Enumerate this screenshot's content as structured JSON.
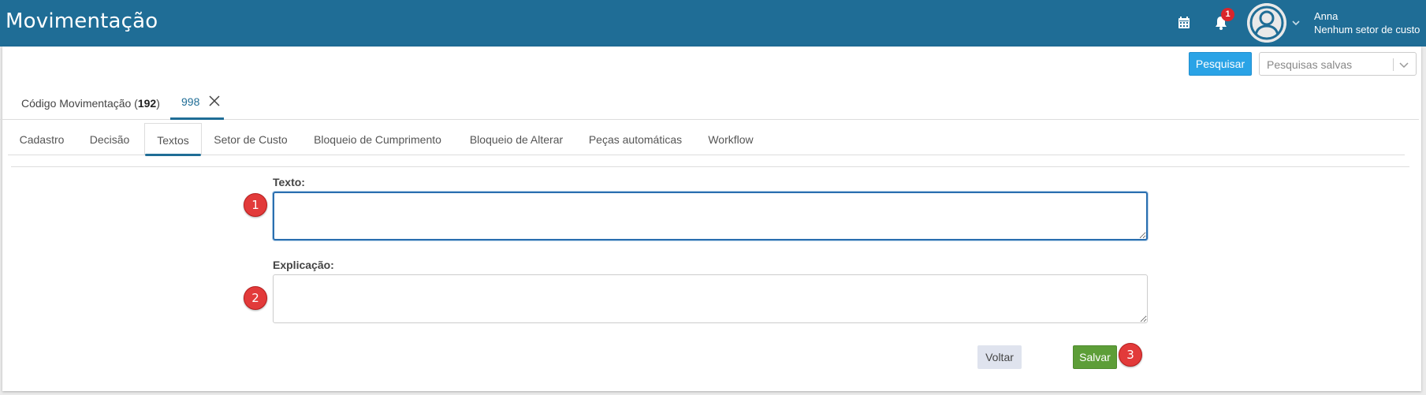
{
  "header": {
    "title": "Movimentação",
    "notification_count": "1",
    "user_name": "Anna",
    "user_sector": "Nenhum setor de custo"
  },
  "search": {
    "button_label": "Pesquisar",
    "saved_placeholder": "Pesquisas salvas"
  },
  "record_tabs": {
    "code_label": "Código Movimentação (",
    "code_value": "192",
    "code_suffix": ")",
    "active_number": "998"
  },
  "sub_tabs": [
    "Cadastro",
    "Decisão",
    "Textos",
    "Setor de Custo",
    "Bloqueio de Cumprimento",
    "Bloqueio de Alterar",
    "Peças automáticas",
    "Workflow"
  ],
  "active_sub_tab": "Textos",
  "form": {
    "texto_label": "Texto:",
    "texto_value": "",
    "explicacao_label": "Explicação:",
    "explicacao_value": ""
  },
  "markers": [
    "1",
    "2",
    "3"
  ],
  "actions": {
    "back_label": "Voltar",
    "save_label": "Salvar"
  },
  "colors": {
    "header_bg": "#1f6d96",
    "primary_button": "#2aa3e6",
    "save_button": "#5d9e38",
    "marker": "#e23a3a"
  }
}
